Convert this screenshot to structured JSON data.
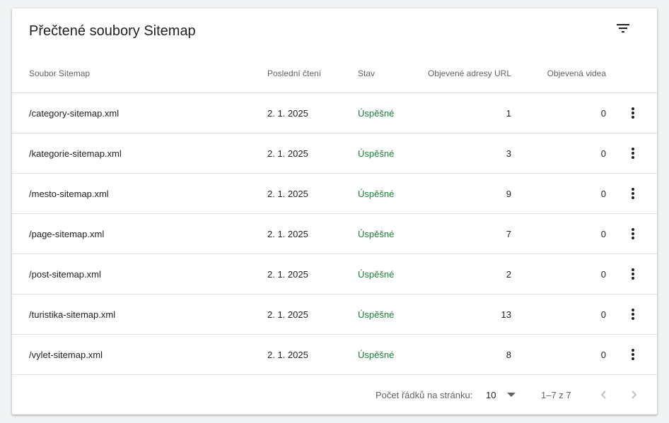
{
  "card": {
    "title": "Přečtené soubory Sitemap",
    "filter_icon": "filter-list-icon"
  },
  "table": {
    "columns": [
      "Soubor Sitemap",
      "Poslední čtení",
      "Stav",
      "Objevené adresy URL",
      "Objevená videa"
    ],
    "rows": [
      {
        "sitemap": "/category-sitemap.xml",
        "last_read": "2. 1. 2025",
        "status": "Úspěšné",
        "urls": "1",
        "videos": "0"
      },
      {
        "sitemap": "/kategorie-sitemap.xml",
        "last_read": "2. 1. 2025",
        "status": "Úspěšné",
        "urls": "3",
        "videos": "0"
      },
      {
        "sitemap": "/mesto-sitemap.xml",
        "last_read": "2. 1. 2025",
        "status": "Úspěšné",
        "urls": "9",
        "videos": "0"
      },
      {
        "sitemap": "/page-sitemap.xml",
        "last_read": "2. 1. 2025",
        "status": "Úspěšné",
        "urls": "7",
        "videos": "0"
      },
      {
        "sitemap": "/post-sitemap.xml",
        "last_read": "2. 1. 2025",
        "status": "Úspěšné",
        "urls": "2",
        "videos": "0"
      },
      {
        "sitemap": "/turistika-sitemap.xml",
        "last_read": "2. 1. 2025",
        "status": "Úspěšné",
        "urls": "13",
        "videos": "0"
      },
      {
        "sitemap": "/vylet-sitemap.xml",
        "last_read": "2. 1. 2025",
        "status": "Úspěšné",
        "urls": "8",
        "videos": "0"
      }
    ],
    "row_menu_icon": "more-vert-icon"
  },
  "footer": {
    "rows_per_page_label": "Počet řádků na stránku:",
    "rows_per_page_value": "10",
    "range": "1–7 z 7",
    "prev_icon": "chevron-left-icon",
    "next_icon": "chevron-right-icon"
  },
  "colors": {
    "status_success": "#188038",
    "text_primary": "#202124",
    "text_secondary": "#5f6368",
    "divider": "#e0e0e0"
  }
}
